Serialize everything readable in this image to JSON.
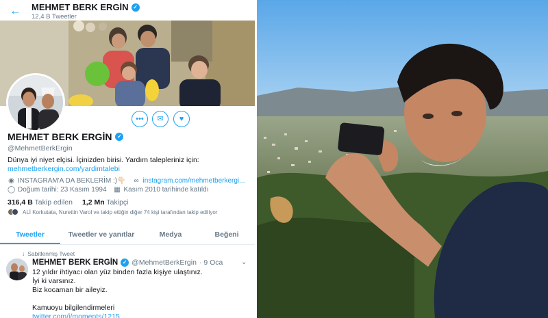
{
  "header": {
    "name": "MEHMET BERK ERGİN",
    "tweet_count": "12,4 B Tweetler",
    "back_icon": "arrow-left-icon"
  },
  "profile": {
    "name": "MEHMET BERK ERGİN",
    "handle": "@MehmetBerkErgin",
    "bio_line": "Dünya iyi niyet elçisi. İçinizden birisi. Yardım talepleriniz için:",
    "bio_link": "mehmetberkergin.com/yardimtalebi",
    "location": "INSTAGRAM'A DA BEKLERİM :)👇🏻",
    "website": "instagram.com/mehmetberkergi...",
    "birthday": "Doğum tarihi: 23 Kasım 1994",
    "joined": "Kasım 2010 tarihinde katıldı",
    "following_count": "316,4 B",
    "following_label": "Takip edilen",
    "followers_count": "1,2 Mn",
    "followers_label": "Takipçi",
    "followed_by": "ALİ Korkutata, Nurettin Varol ve takip ettiğin diğer 74 kişi tarafından takip ediliyor"
  },
  "actions": {
    "more_label": "•••",
    "message_icon": "envelope-icon",
    "notify_icon": "bell-plus-icon"
  },
  "tabs": [
    {
      "label": "Tweetler",
      "active": true
    },
    {
      "label": "Tweetler ve yanıtlar",
      "active": false
    },
    {
      "label": "Medya",
      "active": false
    },
    {
      "label": "Beğeni",
      "active": false
    }
  ],
  "pinned_tweet": {
    "pinned_label": "Sabitlenmiş Tweet",
    "name": "MEHMET BERK ERGİN",
    "handle": "@MehmetBerkErgin",
    "date": "· 9 Oca",
    "lines": [
      "12 yıldır ihtiyacı olan yüz binden fazla kişiye ulaştınız.",
      "İyi ki varsınız.",
      "Biz kocaman bir aileyiz.",
      "",
      "Kamuoyu bilgilendirmeleri"
    ],
    "link": "twitter.com/i/moments/1215..."
  },
  "colors": {
    "accent": "#1da1f2",
    "muted": "#657786",
    "text": "#14171a",
    "border": "#e6ecf0"
  }
}
